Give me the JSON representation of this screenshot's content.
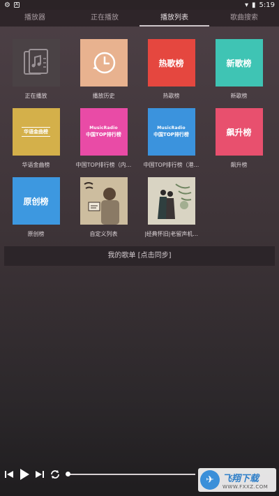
{
  "status": {
    "time": "5:19"
  },
  "tabs": [
    {
      "label": "播放器"
    },
    {
      "label": "正在播放"
    },
    {
      "label": "播放列表"
    },
    {
      "label": "歌曲搜索"
    }
  ],
  "grid": [
    {
      "label": "正在播放"
    },
    {
      "label": "播放历史"
    },
    {
      "label": "热歌榜",
      "tile_text": "热歌榜"
    },
    {
      "label": "新歌榜",
      "tile_text": "新歌榜"
    },
    {
      "label": "华语金曲榜",
      "tile_text": "华语金曲榜"
    },
    {
      "label": "中国TOP排行榜（内...",
      "tile_small": "MusicRadio",
      "tile_big": "中国TOP排行榜"
    },
    {
      "label": "中国TOP排行榜（港...",
      "tile_small": "MusicRadio",
      "tile_big": "中国TOP排行榜"
    },
    {
      "label": "飙升榜",
      "tile_text": "飙升榜"
    },
    {
      "label": "原创榜",
      "tile_text": "原创榜"
    },
    {
      "label": "自定义列表"
    },
    {
      "label": "|经典怀旧|老留声机..."
    }
  ],
  "my_list": "我的歌单 [点击同步]",
  "watermark": {
    "title": "飞翔下载",
    "url": "WWW.FXXZ.COM"
  }
}
